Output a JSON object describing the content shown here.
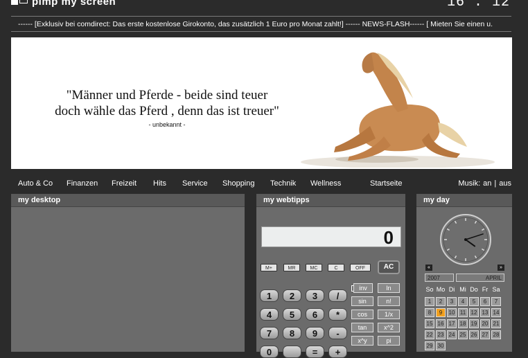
{
  "header": {
    "logo_text": "pimp my screen",
    "time": "16 : 12",
    "ticker": "------ [Exklusiv bei comdirect: Das erste kostenlose Girokonto, das zusätzlich 1 Euro pro Monat zahlt!] ------ NEWS-FLASH------ [ Mieten Sie einen u."
  },
  "banner": {
    "quote_line1": "\"Männer und Pferde - beide sind teuer",
    "quote_line2": "doch wähle das Pferd , denn das ist treuer\"",
    "author": "- unbekannt -"
  },
  "nav": {
    "items": [
      "Auto & Co",
      "Finanzen",
      "Freizeit",
      "Hits",
      "Service",
      "Shopping",
      "Technik",
      "Wellness"
    ],
    "home": "Startseite",
    "music_label": "Musik:",
    "music_on": "an",
    "music_sep": "|",
    "music_off": "aus"
  },
  "panels": {
    "desktop_title": "my desktop",
    "webtipps_title": "my webtipps",
    "day_title": "my day"
  },
  "calculator": {
    "display": "0",
    "memory_buttons": [
      "M+",
      "MR",
      "MC",
      "C",
      "OFF"
    ],
    "ac": "AC",
    "keys": [
      [
        "1",
        "2",
        "3",
        "/"
      ],
      [
        "4",
        "5",
        "6",
        "*"
      ],
      [
        "7",
        "8",
        "9",
        "-"
      ],
      [
        "0",
        "",
        "=",
        "+"
      ]
    ],
    "functions": [
      [
        "inv",
        "ln"
      ],
      [
        "sin",
        "n!"
      ],
      [
        "cos",
        "1/x"
      ],
      [
        "tan",
        "x^2"
      ],
      [
        "x^y",
        "pi"
      ]
    ]
  },
  "calendar": {
    "year": "2007",
    "month": "APRIL",
    "prev": "«",
    "next": "»",
    "weekdays": [
      "So",
      "Mo",
      "Di",
      "Mi",
      "Do",
      "Fr",
      "Sa"
    ],
    "weeks": [
      [
        "1",
        "2",
        "3",
        "4",
        "5",
        "6",
        "7"
      ],
      [
        "8",
        "9",
        "10",
        "11",
        "12",
        "13",
        "14"
      ],
      [
        "15",
        "16",
        "17",
        "18",
        "19",
        "20",
        "21"
      ],
      [
        "22",
        "23",
        "24",
        "25",
        "26",
        "27",
        "28"
      ],
      [
        "29",
        "30",
        "",
        "",
        "",
        "",
        ""
      ]
    ],
    "today": "9",
    "clock": {
      "hour": 4,
      "minute": 12
    }
  },
  "colors": {
    "background": "#2b2b2b",
    "panel": "#6b6b6b",
    "today_highlight": "#f2a01e"
  }
}
